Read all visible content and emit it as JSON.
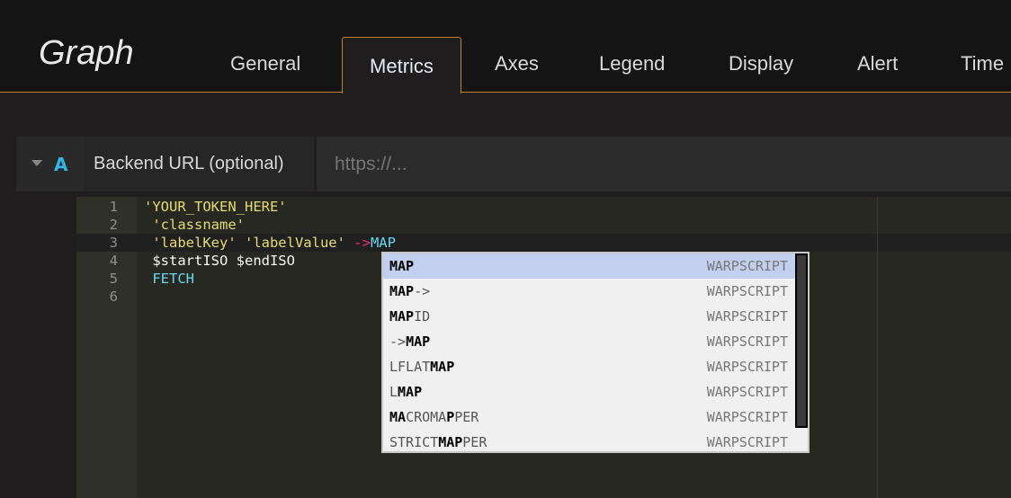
{
  "header": {
    "title": "Graph",
    "tabs": [
      {
        "label": "General"
      },
      {
        "label": "Metrics",
        "active": true
      },
      {
        "label": "Axes"
      },
      {
        "label": "Legend"
      },
      {
        "label": "Display"
      },
      {
        "label": "Alert"
      },
      {
        "label": "Time"
      }
    ]
  },
  "query": {
    "letter": "A",
    "backend_label": "Backend URL (optional)",
    "url_placeholder": "https://...",
    "url_value": ""
  },
  "editor": {
    "lines": [
      {
        "n": "1",
        "tokens": [
          {
            "t": "'YOUR_TOKEN_HERE'",
            "c": "s"
          }
        ]
      },
      {
        "n": "2",
        "tokens": [
          {
            "t": " 'classname'",
            "c": "s"
          }
        ]
      },
      {
        "n": "3",
        "tokens": [
          {
            "t": " 'labelKey' 'labelValue' ",
            "c": "s"
          },
          {
            "t": "->",
            "c": "o"
          },
          {
            "t": "MAP",
            "c": "k"
          }
        ]
      },
      {
        "n": "4",
        "tokens": [
          {
            "t": " $startISO $endISO",
            "c": ""
          }
        ]
      },
      {
        "n": "5",
        "tokens": [
          {
            "t": " FETCH",
            "c": "k"
          }
        ]
      },
      {
        "n": "6",
        "tokens": []
      }
    ]
  },
  "autocomplete": {
    "items": [
      {
        "parts": [
          {
            "t": "MAP",
            "b": true
          }
        ],
        "meta": "WARPSCRIPT",
        "selected": true
      },
      {
        "parts": [
          {
            "t": "MAP",
            "b": true
          },
          {
            "t": "->",
            "b": false
          }
        ],
        "meta": "WARPSCRIPT"
      },
      {
        "parts": [
          {
            "t": "MAP",
            "b": true
          },
          {
            "t": "ID",
            "b": false
          }
        ],
        "meta": "WARPSCRIPT"
      },
      {
        "parts": [
          {
            "t": "->",
            "b": false
          },
          {
            "t": "MAP",
            "b": true
          }
        ],
        "meta": "WARPSCRIPT"
      },
      {
        "parts": [
          {
            "t": "LFLAT",
            "b": false
          },
          {
            "t": "MAP",
            "b": true
          }
        ],
        "meta": "WARPSCRIPT"
      },
      {
        "parts": [
          {
            "t": "L",
            "b": false
          },
          {
            "t": "MAP",
            "b": true
          }
        ],
        "meta": "WARPSCRIPT"
      },
      {
        "parts": [
          {
            "t": "MA",
            "b": true
          },
          {
            "t": "CROMA",
            "b": false
          },
          {
            "t": "P",
            "b": true
          },
          {
            "t": "PER",
            "b": false
          }
        ],
        "meta": "WARPSCRIPT"
      },
      {
        "parts": [
          {
            "t": "STRICT",
            "b": false
          },
          {
            "t": "MAP",
            "b": true
          },
          {
            "t": "PER",
            "b": false
          }
        ],
        "meta": "WARPSCRIPT"
      }
    ]
  }
}
